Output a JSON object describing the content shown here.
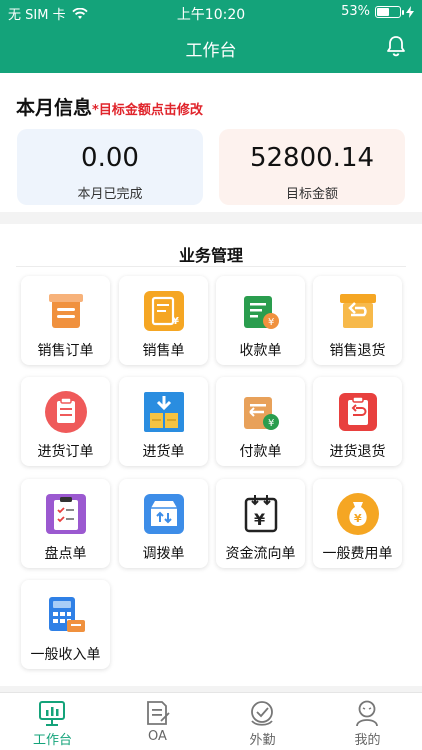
{
  "status_bar": {
    "carrier": "无 SIM 卡",
    "time": "上午10:20",
    "battery": "53%",
    "battery_level": 0.53
  },
  "nav": {
    "title": "工作台",
    "bell_icon": "bell-icon"
  },
  "month_info": {
    "title": "本月信息",
    "hint": "*目标金额点击修改",
    "completed_value": "0.00",
    "completed_label": "本月已完成",
    "target_value": "52800.14",
    "target_label": "目标金额"
  },
  "business": {
    "title": "业务管理",
    "items": [
      {
        "label": "销售订单",
        "icon": "sales-order-icon",
        "color": "#f0913e"
      },
      {
        "label": "销售单",
        "icon": "sales-slip-icon",
        "color": "#f5a623"
      },
      {
        "label": "收款单",
        "icon": "receipt-icon",
        "color": "#2a9d4e"
      },
      {
        "label": "销售退货",
        "icon": "sales-return-icon",
        "color": "#f5a623"
      },
      {
        "label": "进货订单",
        "icon": "purchase-order-icon",
        "color": "#ef5a5a"
      },
      {
        "label": "进货单",
        "icon": "purchase-slip-icon",
        "color": "#2a8de0"
      },
      {
        "label": "付款单",
        "icon": "payment-icon",
        "color": "#e8a15a"
      },
      {
        "label": "进货退货",
        "icon": "purchase-return-icon",
        "color": "#e8403e"
      },
      {
        "label": "盘点单",
        "icon": "inventory-check-icon",
        "color": "#9b59d0"
      },
      {
        "label": "调拨单",
        "icon": "transfer-icon",
        "color": "#3d8de8"
      },
      {
        "label": "资金流向单",
        "icon": "cash-flow-icon",
        "color": "#222222"
      },
      {
        "label": "一般费用单",
        "icon": "expense-icon",
        "color": "#f5a623"
      },
      {
        "label": "一般收入单",
        "icon": "income-icon",
        "color": "#2f80e6"
      }
    ]
  },
  "tabs": [
    {
      "label": "工作台",
      "icon": "workbench-icon",
      "active": true
    },
    {
      "label": "OA",
      "icon": "oa-icon",
      "active": false
    },
    {
      "label": "外勤",
      "icon": "field-work-icon",
      "active": false
    },
    {
      "label": "我的",
      "icon": "profile-icon",
      "active": false
    }
  ],
  "colors": {
    "primary": "#14a37a",
    "hint_red": "#e0242b"
  }
}
